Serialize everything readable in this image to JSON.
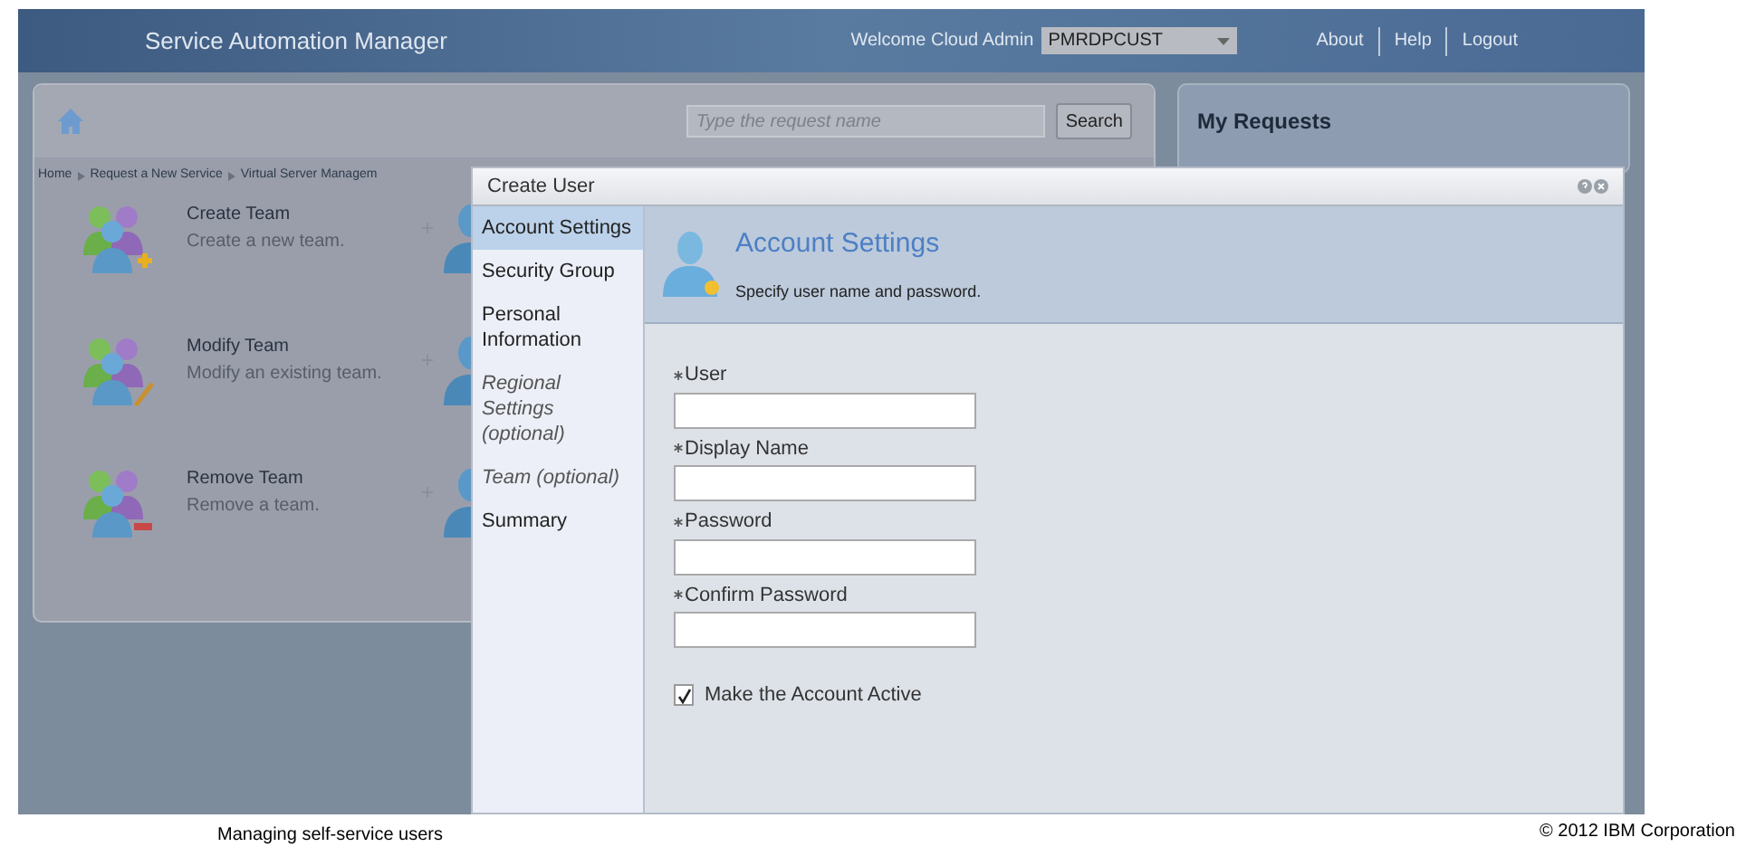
{
  "header": {
    "title": "Service Automation Manager",
    "welcome": "Welcome Cloud Admin",
    "account_select": "PMRDPCUST",
    "links": [
      "About",
      "Help",
      "Logout"
    ]
  },
  "toolbar": {
    "search_placeholder": "Type the request name",
    "search_button": "Search"
  },
  "breadcrumb": [
    "Home",
    "Request a New Service",
    "Virtual Server Managem"
  ],
  "offerings": [
    {
      "title": "Create Team",
      "description": "Create a new team.",
      "kind": "add"
    },
    {
      "title": "Modify Team",
      "description": "Modify an existing team.",
      "kind": "edit"
    },
    {
      "title": "Remove Team",
      "description": "Remove a team.",
      "kind": "remove"
    }
  ],
  "my_requests": {
    "title": "My Requests"
  },
  "dialog": {
    "title": "Create User",
    "steps": [
      {
        "label": "Account Settings",
        "selected": true,
        "optional": false
      },
      {
        "label": "Security Group",
        "selected": false,
        "optional": false
      },
      {
        "label": "Personal Information",
        "selected": false,
        "optional": false
      },
      {
        "label": "Regional Settings (optional)",
        "selected": false,
        "optional": true
      },
      {
        "label": "Team (optional)",
        "selected": false,
        "optional": true
      },
      {
        "label": "Summary",
        "selected": false,
        "optional": false
      }
    ],
    "section": {
      "title": "Account Settings",
      "subtitle": "Specify user name and password."
    },
    "fields": [
      {
        "label": "User",
        "required": true
      },
      {
        "label": "Display Name",
        "required": true
      },
      {
        "label": "Password",
        "required": true
      },
      {
        "label": "Confirm Password",
        "required": true
      }
    ],
    "active_checkbox": {
      "label": "Make the Account Active",
      "checked": true
    }
  },
  "footer": {
    "caption": "Managing self-service users",
    "copyright": "© 2012 IBM Corporation"
  }
}
